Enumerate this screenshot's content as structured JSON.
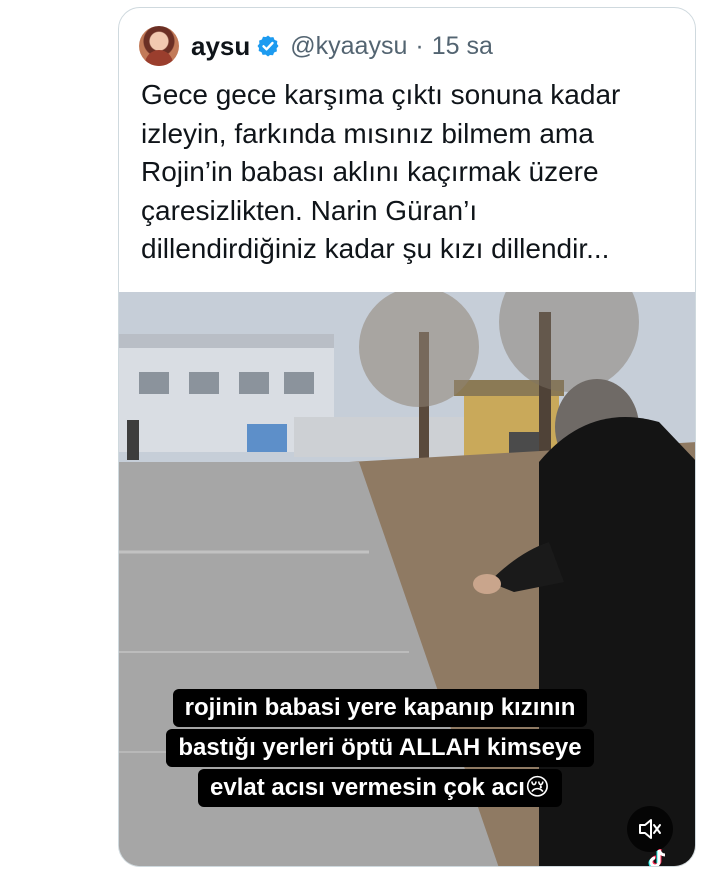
{
  "tweet": {
    "author_name": "aysu",
    "handle": "@kyaaysu",
    "separator": "·",
    "time": "15 sa",
    "text_lines": [
      "Gece gece karşıma çıktı sonuna kadar",
      "izleyin, farkında mısınız bilmem ama",
      "Rojin’in babası aklını kaçırmak üzere",
      "çaresizlikten. Narin Güran’ı",
      "dillendirdiğiniz kadar şu kızı dillendir..."
    ]
  },
  "video": {
    "caption_lines": [
      "rojinin babasi yere kapanıp kızının",
      "bastığı yerleri öptü ALLAH kimseye",
      "evlat acısı vermesin çok acı😢"
    ],
    "mute_icon": "speaker-muted-icon",
    "watermark_icon": "tiktok-icon"
  },
  "colors": {
    "text_primary": "#0f1419",
    "text_secondary": "#536471",
    "verified_blue": "#1d9bf0",
    "card_border": "#cfd9de"
  }
}
